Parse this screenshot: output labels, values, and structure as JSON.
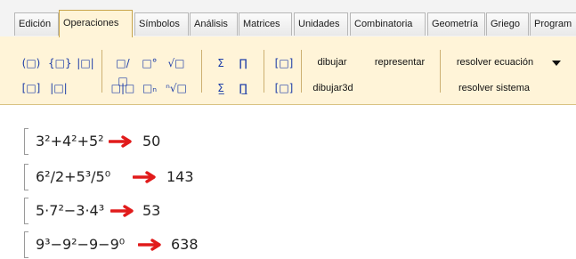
{
  "tabs": [
    "Edición",
    "Operaciones",
    "Símbolos",
    "Análisis",
    "Matrices",
    "Unidades",
    "Combinatoria",
    "Geometría",
    "Griego",
    "Program"
  ],
  "active_tab": "Operaciones",
  "ribbon": {
    "row1": [
      "(□)",
      "{□}",
      "|□|",
      "□/□",
      "□°",
      "√□",
      "Σ",
      "∏",
      "[□]"
    ],
    "row2": [
      "[□]",
      "|□|",
      "□|□",
      "□ₙ",
      "ⁿ√□",
      "Σ̲",
      "∏̲",
      "[□]"
    ],
    "dibujar": "dibujar",
    "representar": "representar",
    "dibujar3d": "dibujar3d",
    "resolver_ecuacion": "resolver ecuación",
    "resolver_sistema": "resolver sistema"
  },
  "worksheet": {
    "arrow_color": "#e11b1b",
    "rows": [
      {
        "expr": "3²+4²+5²",
        "result": "50"
      },
      {
        "expr": "6²/2+5³/5⁰",
        "result": "143"
      },
      {
        "expr": "5·7²−3·4³",
        "result": "53"
      },
      {
        "expr": "9³−9²−9−9⁰",
        "result": "638"
      }
    ]
  }
}
